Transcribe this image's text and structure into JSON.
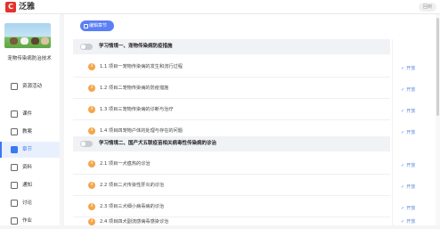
{
  "app": {
    "brand": "泛雅",
    "top_right": "回到"
  },
  "course": {
    "name": "宠物传染病防治技术"
  },
  "sidebar": {
    "items": [
      {
        "label": "资源活动",
        "active": false
      },
      {
        "label": "课件",
        "active": false
      },
      {
        "label": "教案",
        "active": false
      },
      {
        "label": "章节",
        "active": true
      },
      {
        "label": "资料",
        "active": false
      },
      {
        "label": "通知",
        "active": false
      },
      {
        "label": "讨论",
        "active": false
      },
      {
        "label": "作业",
        "active": false
      }
    ]
  },
  "toolbar": {
    "edit_label": "编辑章节"
  },
  "chapters": [
    {
      "title": "学习情境一、宠物传染病防疫措施",
      "lessons": [
        {
          "num": "4",
          "title": "1.1 项目一宠物传染病的发生和流行过程",
          "status": "开放"
        },
        {
          "num": "4",
          "title": "1.2 项目二宠物传染病的防疫措施",
          "status": "开放"
        },
        {
          "num": "4",
          "title": "1.3 项目三宠物传染病的诊断与治疗",
          "status": "开放"
        },
        {
          "num": "4",
          "title": "1.4 项目四宠物户体的处理与存在的问题",
          "status": "开放"
        }
      ]
    },
    {
      "title": "学习情境二、国产犬五联疫苗相关病毒性传染病的诊治",
      "lessons": [
        {
          "num": "4",
          "title": "2.1 项目一犬瘟热的诊治",
          "status": "开放"
        },
        {
          "num": "4",
          "title": "2.2 项目二犬传染性肝炎的诊治",
          "status": "开放"
        },
        {
          "num": "4",
          "title": "2.3 项目三犬细小病毒病的诊治",
          "status": "开放"
        },
        {
          "num": "4",
          "title": "2.4 项目四犬副流感病毒感染诊治",
          "status": "开放"
        }
      ]
    }
  ],
  "colors": {
    "accent": "#3a79f0",
    "edit_button": "#5b7ff5",
    "lesson_num": "#f5a54a",
    "status": "#5a86d8",
    "brand_logo": "#e5322d"
  }
}
